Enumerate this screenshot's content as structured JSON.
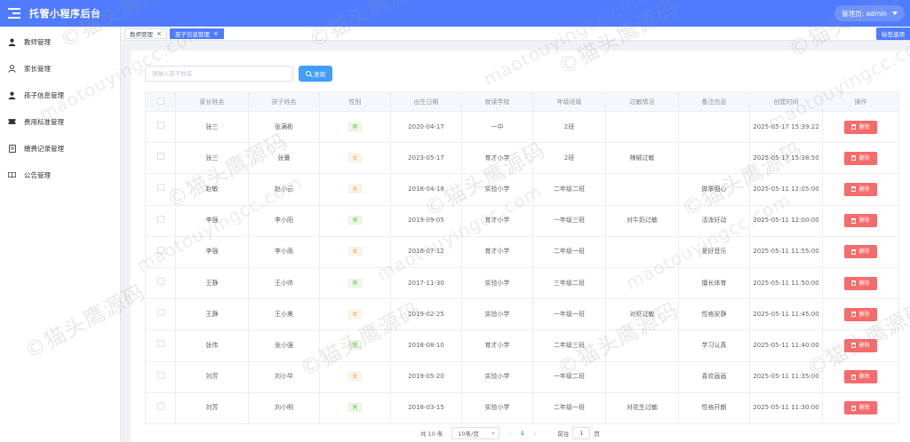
{
  "app": {
    "title": "托管小程序后台",
    "user_label": "管理员: admin"
  },
  "sidebar": {
    "items": [
      {
        "label": "教师管理",
        "icon": "user-icon"
      },
      {
        "label": "家长管理",
        "icon": "user-outline-icon"
      },
      {
        "label": "孩子信息管理",
        "icon": "user-icon"
      },
      {
        "label": "费用标准管理",
        "icon": "ticket-icon"
      },
      {
        "label": "缴费记录管理",
        "icon": "document-icon"
      },
      {
        "label": "公告管理",
        "icon": "book-icon"
      }
    ]
  },
  "tabs": {
    "items": [
      {
        "label": "教师管理",
        "active": false
      },
      {
        "label": "孩子信息管理",
        "active": true
      }
    ],
    "close_glyph": "×",
    "option_label": "标签选项"
  },
  "search": {
    "placeholder": "请输入孩子姓名",
    "button_label": "查询"
  },
  "table": {
    "columns": [
      "家长姓名",
      "孩子姓名",
      "性别",
      "出生日期",
      "就读学校",
      "年级班级",
      "过敏情况",
      "备注信息",
      "创建时间",
      "操作"
    ],
    "delete_label": "删除",
    "rows": [
      {
        "parent": "张三",
        "child": "张满彬",
        "gender": "男",
        "birth": "2020-04-17",
        "school": "一中",
        "grade": "2班",
        "allergy": "",
        "note": "",
        "created": "2025-05-17 15:39:22"
      },
      {
        "parent": "张三",
        "child": "张叠",
        "gender": "女",
        "birth": "2023-05-17",
        "school": "育才小学",
        "grade": "2班",
        "allergy": "辣椒过敏",
        "note": "",
        "created": "2025-05-17 15:38:50"
      },
      {
        "parent": "赵敏",
        "child": "赵小云",
        "gender": "女",
        "birth": "2018-04-18",
        "school": "实验小学",
        "grade": "二年级二班",
        "allergy": "",
        "note": "做事细心",
        "created": "2025-05-11 12:05:00"
      },
      {
        "parent": "李强",
        "child": "李小阳",
        "gender": "男",
        "birth": "2019-09-05",
        "school": "育才小学",
        "grade": "一年级三班",
        "allergy": "对牛奶过敏",
        "note": "活泼好动",
        "created": "2025-05-11 12:00:00"
      },
      {
        "parent": "李强",
        "child": "李小雨",
        "gender": "女",
        "birth": "2018-07-12",
        "school": "育才小学",
        "grade": "二年级一班",
        "allergy": "",
        "note": "爱好音乐",
        "created": "2025-05-11 11:55:00"
      },
      {
        "parent": "王静",
        "child": "王小帅",
        "gender": "男",
        "birth": "2017-11-30",
        "school": "实验小学",
        "grade": "三年级二班",
        "allergy": "",
        "note": "擅长体育",
        "created": "2025-05-11 11:50:00"
      },
      {
        "parent": "王静",
        "child": "王小美",
        "gender": "女",
        "birth": "2019-02-25",
        "school": "实验小学",
        "grade": "一年级一班",
        "allergy": "对虾过敏",
        "note": "性格安静",
        "created": "2025-05-11 11:45:00"
      },
      {
        "parent": "张伟",
        "child": "张小强",
        "gender": "男",
        "birth": "2018-08-10",
        "school": "育才小学",
        "grade": "二年级三班",
        "allergy": "",
        "note": "学习认真",
        "created": "2025-05-11 11:40:00"
      },
      {
        "parent": "刘芳",
        "child": "刘小华",
        "gender": "女",
        "birth": "2019-05-20",
        "school": "实验小学",
        "grade": "一年级二班",
        "allergy": "",
        "note": "喜欢画画",
        "created": "2025-05-11 11:35:00"
      },
      {
        "parent": "刘芳",
        "child": "刘小明",
        "gender": "男",
        "birth": "2018-03-15",
        "school": "实验小学",
        "grade": "二年级一班",
        "allergy": "对花生过敏",
        "note": "性格开朗",
        "created": "2025-05-11 11:30:00"
      }
    ]
  },
  "pagination": {
    "total": "共 10 条",
    "page_size": "10条/页",
    "prev": "‹",
    "current_page": "1",
    "next": "›",
    "goto_label": "前往",
    "goto_value": "1",
    "page_suffix": "页"
  },
  "watermark": {
    "text_cn": "©猫头鹰源码",
    "text_en": "maotouyingcc.com"
  },
  "colors": {
    "primary": "#4f7cff",
    "button": "#409eff",
    "danger": "#f56c6c",
    "male": "#67c23a",
    "female": "#e6a23c"
  }
}
